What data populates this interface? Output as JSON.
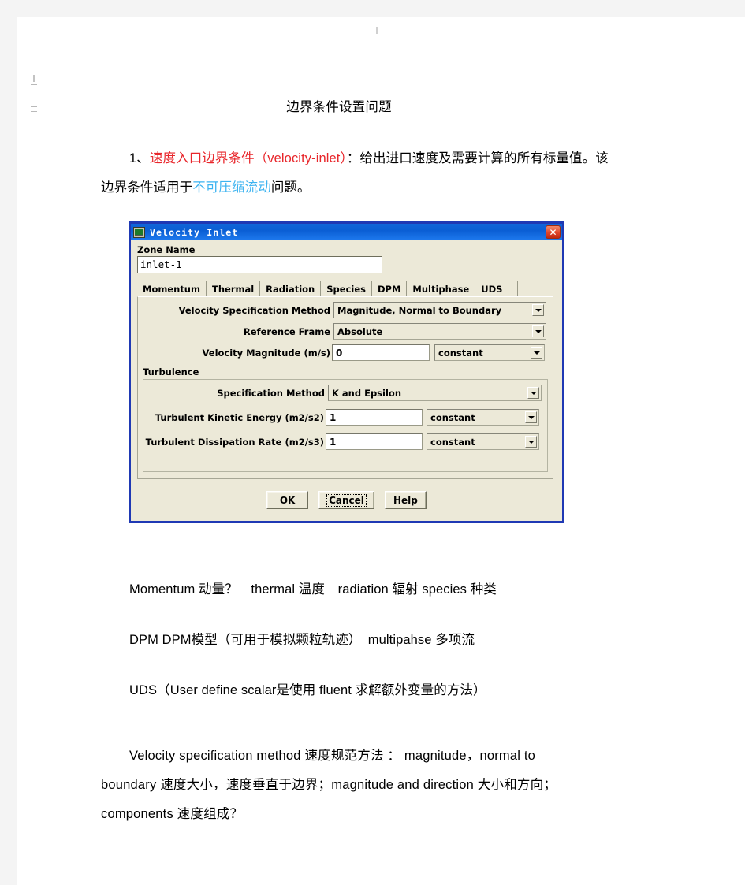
{
  "document": {
    "title": "边界条件设置问题",
    "paragraph1": {
      "line1_prefix": "1、",
      "line1_red": "速度入口边界条件（velocity-inlet）",
      "line1_rest": "：给出进口速度及需要计算的所有标量值。该",
      "line2_pre": "边界条件适用于",
      "line2_blue": "不可压缩流动",
      "line2_post": "问题。"
    },
    "paragraph2": "Momentum 动量？　thermal 温度　radiation 辐射 species 种类",
    "paragraph3": "DPM DPM模型（可用于模拟颗粒轨迹）　multipahse 多项流",
    "paragraph4": "UDS（User define scalar是使用 fluent 求解额外变量的方法）",
    "paragraph5": {
      "line1": "Velocity  specification  method  速度规范方法  ：  magnitude，normal  to",
      "line2": "boundary  速度大小，速度垂直于边界；magnitude  and  direction  大小和方向；",
      "line3": "components  速度组成？"
    }
  },
  "dialog": {
    "title": "Velocity Inlet",
    "close_label": "✕",
    "zone_name_label": "Zone Name",
    "zone_name_value": "inlet-1",
    "tabs": [
      {
        "label": "Momentum",
        "selected": true
      },
      {
        "label": "Thermal",
        "selected": false
      },
      {
        "label": "Radiation",
        "selected": false
      },
      {
        "label": "Species",
        "selected": false
      },
      {
        "label": "DPM",
        "selected": false
      },
      {
        "label": "Multiphase",
        "selected": false
      },
      {
        "label": "UDS",
        "selected": false
      }
    ],
    "momentum": {
      "velocity_spec_method_label": "Velocity Specification Method",
      "velocity_spec_method_value": "Magnitude, Normal to Boundary",
      "reference_frame_label": "Reference Frame",
      "reference_frame_value": "Absolute",
      "velocity_magnitude_label": "Velocity Magnitude (m/s)",
      "velocity_magnitude_value": "0",
      "velocity_magnitude_profile": "constant"
    },
    "turbulence": {
      "group_label": "Turbulence",
      "spec_method_label": "Specification Method",
      "spec_method_value": "K and Epsilon",
      "tke_label": "Turbulent Kinetic Energy (m2/s2)",
      "tke_value": "1",
      "tke_profile": "constant",
      "tdr_label": "Turbulent Dissipation Rate (m2/s3)",
      "tdr_value": "1",
      "tdr_profile": "constant"
    },
    "buttons": {
      "ok": "OK",
      "cancel": "Cancel",
      "help": "Help"
    },
    "colors": {
      "titlebar": "#0a5ed4",
      "frame": "#1f39b4",
      "face": "#ece9d8",
      "close": "#e0452a"
    }
  }
}
